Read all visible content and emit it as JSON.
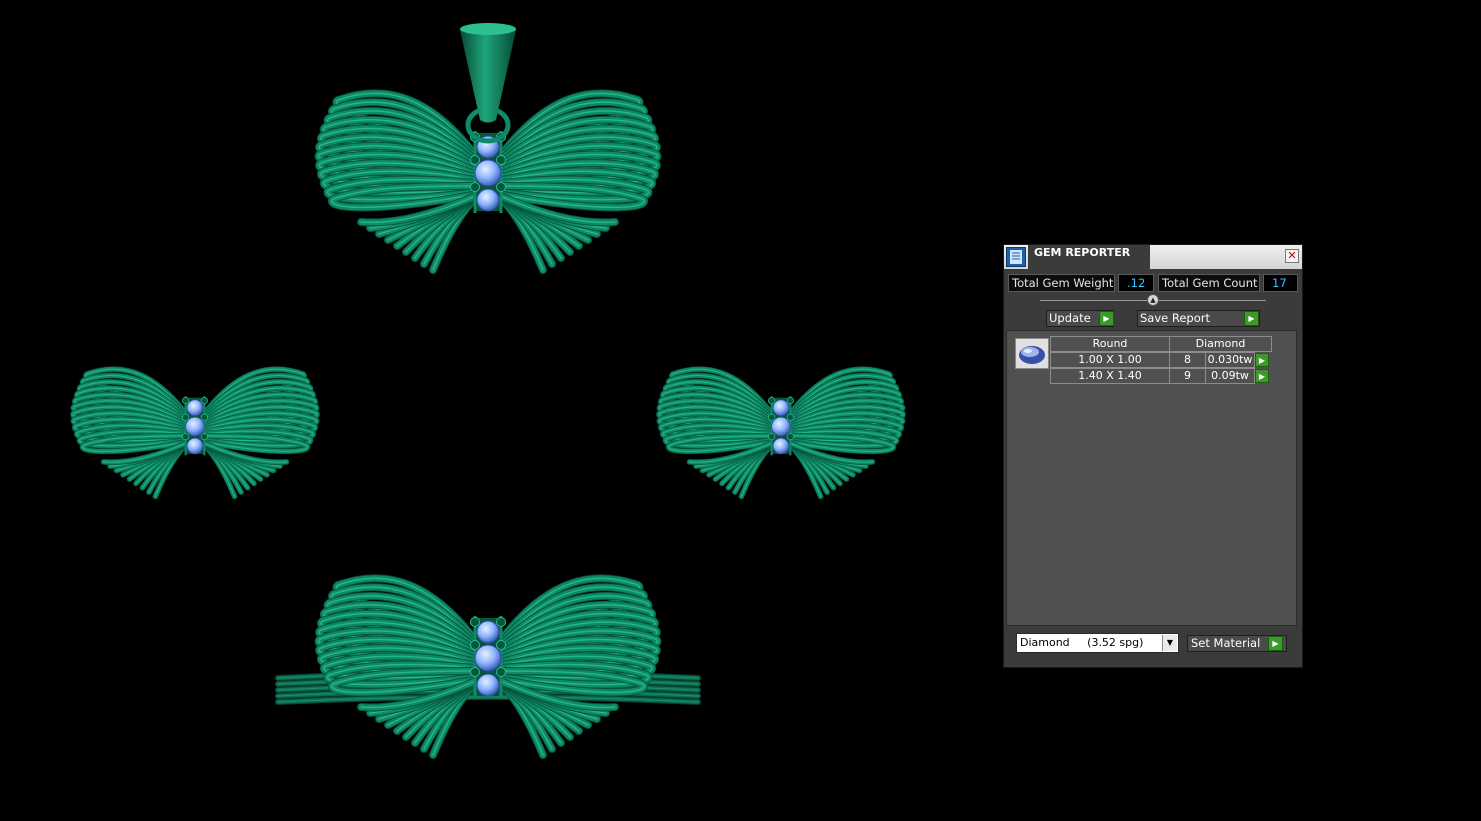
{
  "viewport": {
    "scene": "four green butterfly jewelry models",
    "colors": {
      "metal": "#0d8a66",
      "metal_dark": "#06553d",
      "metal_light": "#2bbf91",
      "gem": "#8fb5ff",
      "background": "#000000"
    }
  },
  "gem_reporter": {
    "title": "GEM REPORTER",
    "close_icon": "close-x-icon",
    "total_gem_weight_label": "Total Gem Weight",
    "total_gem_weight_value": ".12",
    "total_gem_count_label": "Total Gem Count",
    "total_gem_count_value": "17",
    "update_label": "Update",
    "save_report_label": "Save Report",
    "table": {
      "shape": "Round",
      "material": "Diamond",
      "rows": [
        {
          "size": "1.00 X 1.00",
          "count": "8",
          "weight": "0.030tw"
        },
        {
          "size": "1.40 X 1.40",
          "count": "9",
          "weight": "0.09tw"
        }
      ]
    },
    "material_select": {
      "selected": "Diamond     (3.52 spg)"
    },
    "set_material_label": "Set Material",
    "accent_colors": {
      "value_text": "#31c6ff",
      "go_button": "#3c9a2a"
    }
  }
}
